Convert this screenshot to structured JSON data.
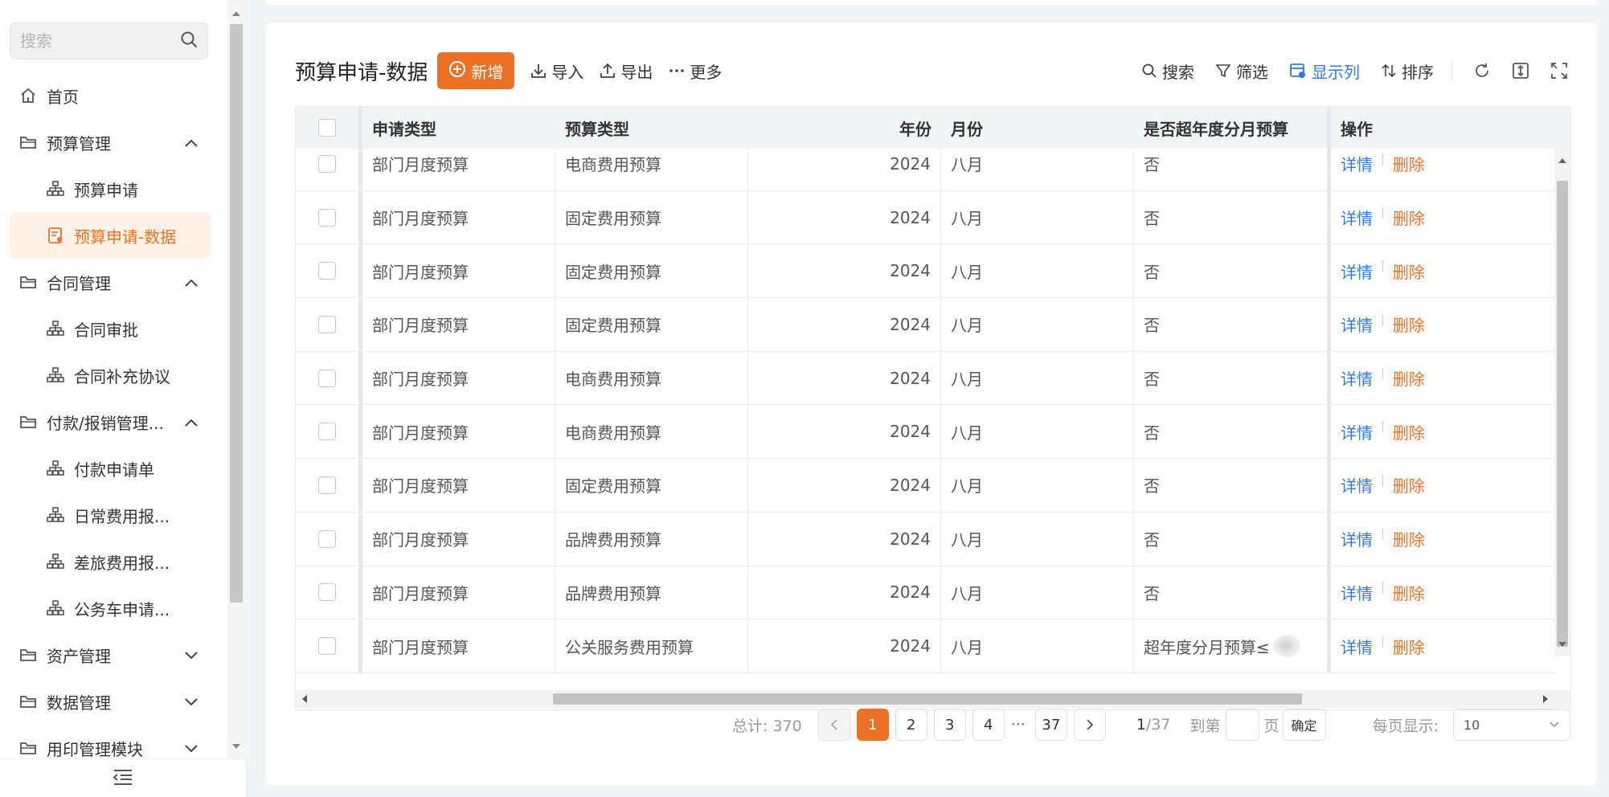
{
  "sidebar": {
    "search_placeholder": "搜索",
    "items": [
      {
        "label": "首页",
        "level": 1,
        "icon": "home-icon"
      },
      {
        "label": "预算管理",
        "level": 1,
        "icon": "folder-icon",
        "expanded": true
      },
      {
        "label": "预算申请",
        "level": 2,
        "icon": "org-chart-icon"
      },
      {
        "label": "预算申请-数据",
        "level": 2,
        "icon": "form-icon",
        "active": true
      },
      {
        "label": "合同管理",
        "level": 1,
        "icon": "folder-icon",
        "expanded": true
      },
      {
        "label": "合同审批",
        "level": 2,
        "icon": "org-chart-icon"
      },
      {
        "label": "合同补充协议",
        "level": 2,
        "icon": "org-chart-icon"
      },
      {
        "label": "付款/报销管理...",
        "level": 1,
        "icon": "folder-icon",
        "expanded": true
      },
      {
        "label": "付款申请单",
        "level": 2,
        "icon": "org-chart-icon"
      },
      {
        "label": "日常费用报...",
        "level": 2,
        "icon": "org-chart-icon"
      },
      {
        "label": "差旅费用报...",
        "level": 2,
        "icon": "org-chart-icon"
      },
      {
        "label": "公务车申请...",
        "level": 2,
        "icon": "org-chart-icon"
      },
      {
        "label": "资产管理",
        "level": 1,
        "icon": "folder-icon",
        "expanded": false
      },
      {
        "label": "数据管理",
        "level": 1,
        "icon": "folder-icon",
        "expanded": false
      },
      {
        "label": "用印管理模块",
        "level": 1,
        "icon": "folder-icon",
        "expanded": false
      }
    ]
  },
  "toolbar": {
    "title": "预算申请-数据",
    "add": "新增",
    "import": "导入",
    "export": "导出",
    "more": "更多",
    "search": "搜索",
    "filter": "筛选",
    "columns": "显示列",
    "sort": "排序"
  },
  "table": {
    "headers": [
      "申请类型",
      "预算类型",
      "年份",
      "月份",
      "是否超年度分月预算",
      "操作"
    ],
    "op_detail": "详情",
    "op_delete": "删除",
    "rows": [
      [
        "部门月度预算",
        "电商费用预算",
        "2024",
        "八月",
        "否"
      ],
      [
        "部门月度预算",
        "固定费用预算",
        "2024",
        "八月",
        "否"
      ],
      [
        "部门月度预算",
        "固定费用预算",
        "2024",
        "八月",
        "否"
      ],
      [
        "部门月度预算",
        "固定费用预算",
        "2024",
        "八月",
        "否"
      ],
      [
        "部门月度预算",
        "电商费用预算",
        "2024",
        "八月",
        "否"
      ],
      [
        "部门月度预算",
        "电商费用预算",
        "2024",
        "八月",
        "否"
      ],
      [
        "部门月度预算",
        "固定费用预算",
        "2024",
        "八月",
        "否"
      ],
      [
        "部门月度预算",
        "品牌费用预算",
        "2024",
        "八月",
        "否"
      ],
      [
        "部门月度预算",
        "品牌费用预算",
        "2024",
        "八月",
        "否"
      ],
      [
        "部门月度预算",
        "公关服务费用预算",
        "2024",
        "八月",
        "超年度分月预算≤"
      ]
    ]
  },
  "pagination": {
    "total": "总计: 370",
    "pages": [
      "1",
      "2",
      "3",
      "4"
    ],
    "ellipsis": "···",
    "last": "37",
    "current": "1",
    "of": "/37",
    "goto_label": "到第",
    "page_unit": "页",
    "confirm": "确定",
    "per_page_label": "每页显示:",
    "per_page_value": "10"
  },
  "colors": {
    "accent": "#ed7124",
    "link": "#2f7ae5"
  }
}
